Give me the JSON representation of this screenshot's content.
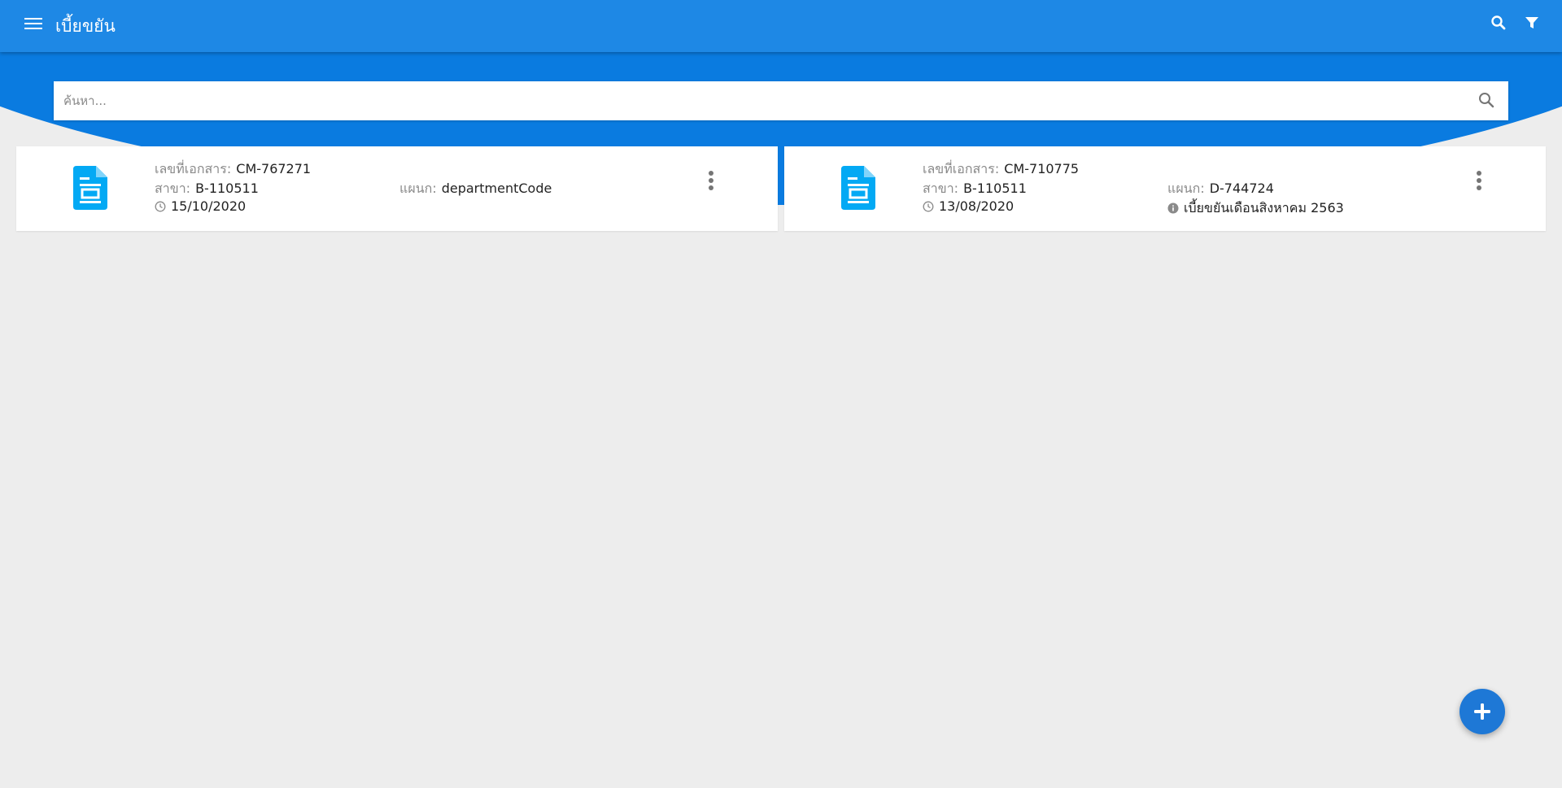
{
  "appbar": {
    "title": "เบี้ยขยัน",
    "icons": [
      "menu-icon",
      "search-icon",
      "filter-icon"
    ]
  },
  "search": {
    "placeholder": "ค้นหา..."
  },
  "cards": [
    {
      "doc_label": "เลขที่เอกสาร:",
      "doc_no": "CM-767271",
      "branch_label": "สาขา:",
      "branch": "B-110511",
      "dept_label": "แผนก:",
      "dept": "departmentCode",
      "date": "15/10/2020",
      "note": ""
    },
    {
      "doc_label": "เลขที่เอกสาร:",
      "doc_no": "CM-710775",
      "branch_label": "สาขา:",
      "branch": "B-110511",
      "dept_label": "แผนก:",
      "dept": "D-744724",
      "date": "13/08/2020",
      "note": "เบี้ยขยันเดือนสิงหาคม 2563"
    }
  ],
  "colors": {
    "primary": "#1e88e5",
    "header_curve": "#0a7be0",
    "doc_icon": "#03a9f4",
    "background": "#ededed"
  }
}
